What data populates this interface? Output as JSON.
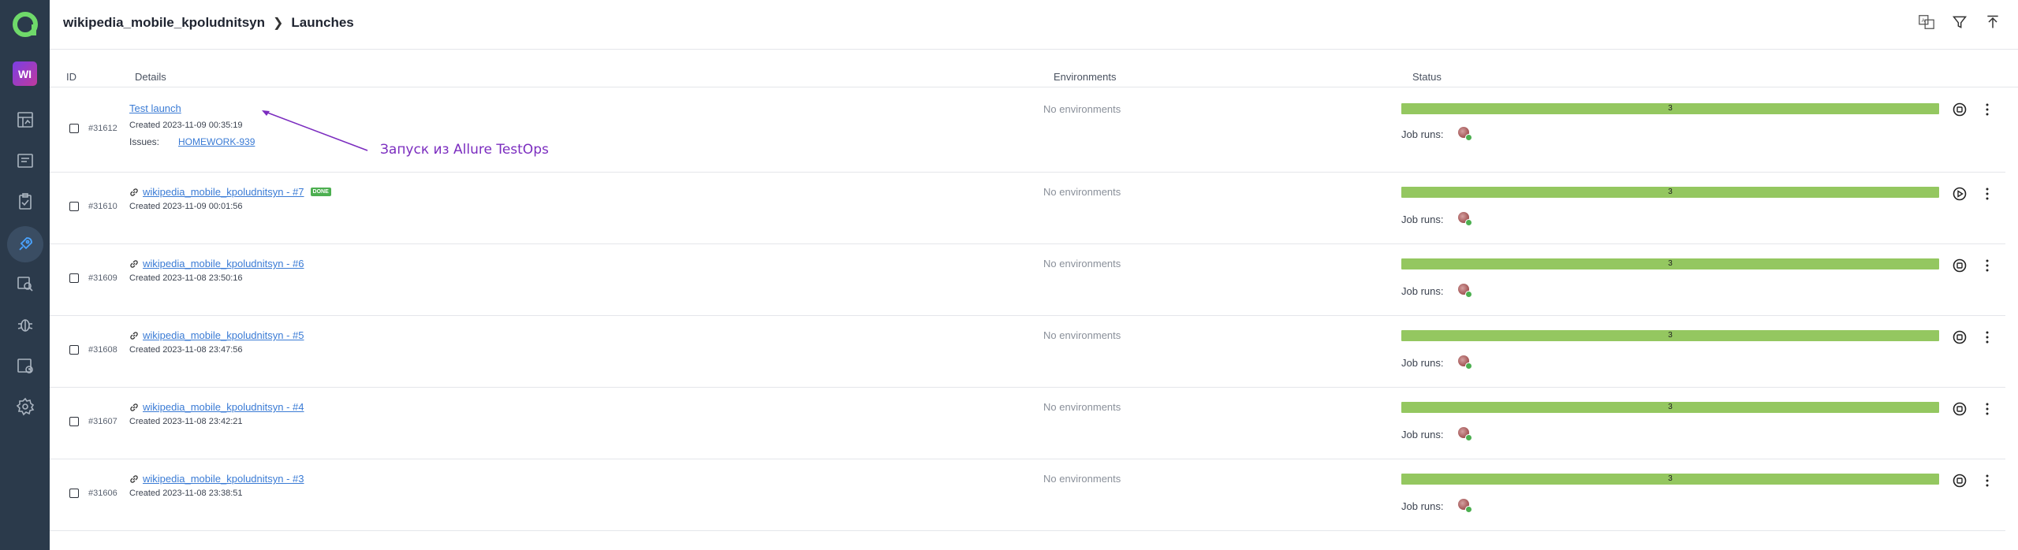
{
  "sidebar": {
    "project_badge": "WI",
    "icons": [
      "dashboard-icon",
      "test-cases-icon",
      "test-plans-icon",
      "launches-icon",
      "analytics-icon",
      "defects-icon",
      "jobs-icon",
      "settings-icon"
    ]
  },
  "header": {
    "project": "wikipedia_mobile_kpoludnitsyn",
    "page": "Launches",
    "tools": [
      "translate-icon",
      "filter-icon",
      "upload-icon"
    ]
  },
  "columns": {
    "id": "ID",
    "details": "Details",
    "environments": "Environments",
    "status": "Status"
  },
  "annotation": "Запуск из Allure TestOps",
  "colors": {
    "accent": "#3a7bd5",
    "bar": "#94c760",
    "sidebar": "#2b3a4b",
    "annotation": "#7b2cbf"
  },
  "rows": [
    {
      "id": "#31612",
      "title": "Test launch",
      "created": "Created 2023-11-09 00:35:19",
      "issues_label": "Issues:",
      "issue": "HOMEWORK-939",
      "env": "No environments",
      "count": "3",
      "job_runs": "Job runs:"
    },
    {
      "id": "#31610",
      "title": "wikipedia_mobile_kpoludnitsyn - #7",
      "badge": "DONE",
      "created": "Created 2023-11-09 00:01:56",
      "env": "No environments",
      "count": "3",
      "job_runs": "Job runs:"
    },
    {
      "id": "#31609",
      "title": "wikipedia_mobile_kpoludnitsyn - #6",
      "created": "Created 2023-11-08 23:50:16",
      "env": "No environments",
      "count": "3",
      "job_runs": "Job runs:"
    },
    {
      "id": "#31608",
      "title": "wikipedia_mobile_kpoludnitsyn - #5",
      "created": "Created 2023-11-08 23:47:56",
      "env": "No environments",
      "count": "3",
      "job_runs": "Job runs:"
    },
    {
      "id": "#31607",
      "title": "wikipedia_mobile_kpoludnitsyn - #4",
      "created": "Created 2023-11-08 23:42:21",
      "env": "No environments",
      "count": "3",
      "job_runs": "Job runs:"
    },
    {
      "id": "#31606",
      "title": "wikipedia_mobile_kpoludnitsyn - #3",
      "created": "Created 2023-11-08 23:38:51",
      "env": "No environments",
      "count": "3",
      "job_runs": "Job runs:"
    }
  ]
}
